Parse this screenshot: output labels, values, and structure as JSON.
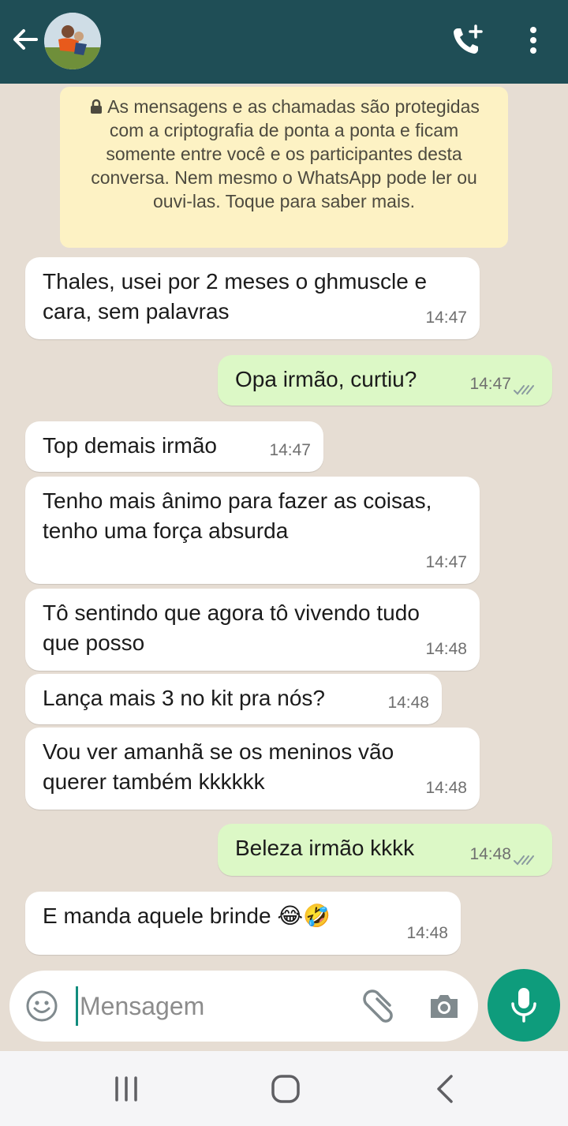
{
  "header": {
    "contact_name": ""
  },
  "notice": {
    "text": "As mensagens e as chamadas são protegidas com a criptografia de ponta a ponta e ficam somente entre você e os participantes desta conversa. Nem mesmo o WhatsApp pode ler ou ouvi-las. Toque para saber mais."
  },
  "messages": [
    {
      "direction": "in",
      "text": "Thales, usei por 2 meses o ghmuscle e cara, sem palavras",
      "time": "14:47"
    },
    {
      "direction": "out",
      "text": "Opa irmão, curtiu?",
      "time": "14:47",
      "status": "read"
    },
    {
      "direction": "in",
      "text": "Top demais irmão",
      "time": "14:47"
    },
    {
      "direction": "in",
      "text": "Tenho mais ânimo para fazer as coisas, tenho uma força absurda",
      "time": "14:47"
    },
    {
      "direction": "in",
      "text": "Tô sentindo que agora tô vivendo tudo que posso",
      "time": "14:48"
    },
    {
      "direction": "in",
      "text": "Lança mais 3 no kit pra nós?",
      "time": "14:48"
    },
    {
      "direction": "in",
      "text": "Vou ver amanhã se os meninos vão querer também kkkkkk",
      "time": "14:48"
    },
    {
      "direction": "out",
      "text": "Beleza irmão kkkk",
      "time": "14:48",
      "status": "read"
    },
    {
      "direction": "in",
      "text": "E manda aquele brinde 😂🤣",
      "time": "14:48"
    }
  ],
  "composer": {
    "placeholder": "Mensagem"
  },
  "colors": {
    "header": "#1f4e56",
    "chat_background": "#e6ddd3",
    "outgoing_bubble": "#dcf8c6",
    "incoming_bubble": "#ffffff",
    "notice": "#fdf2c4",
    "mic_button": "#0e9c7c",
    "read_ticks": "#8a9aa0"
  },
  "icons": [
    "back-arrow-icon",
    "avatar",
    "call-add-icon",
    "more-vert-icon",
    "lock-icon",
    "emoji-icon",
    "attach-icon",
    "camera-icon",
    "mic-icon",
    "recents-icon",
    "home-icon",
    "nav-back-icon"
  ]
}
